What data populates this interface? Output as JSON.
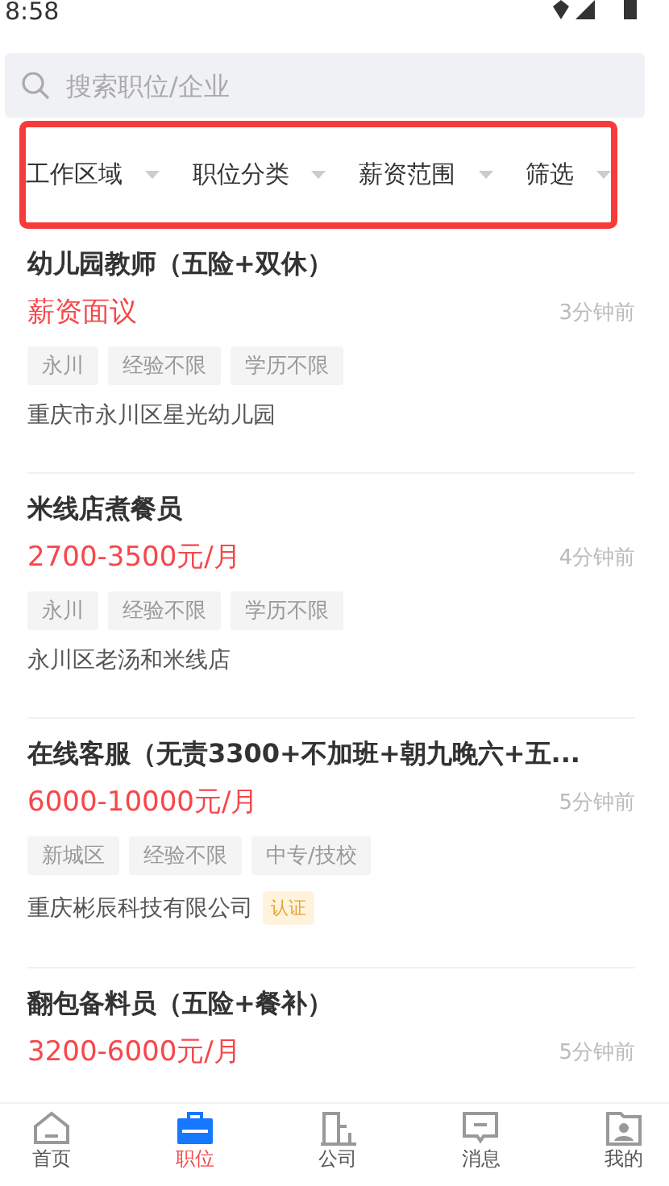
{
  "status_bar": {
    "time": "8:58"
  },
  "search": {
    "placeholder": "搜索职位/企业"
  },
  "filters": [
    {
      "label": "工作区域"
    },
    {
      "label": "职位分类"
    },
    {
      "label": "薪资范围"
    },
    {
      "label": "筛选"
    }
  ],
  "jobs": [
    {
      "title": "幼儿园教师（五险+双休）",
      "salary": "薪资面议",
      "time": "3分钟前",
      "tags": [
        "永川",
        "经验不限",
        "学历不限"
      ],
      "company": "重庆市永川区星光幼儿园"
    },
    {
      "title": "米线店煮餐员",
      "salary": "2700-3500元/月",
      "time": "4分钟前",
      "tags": [
        "永川",
        "经验不限",
        "学历不限"
      ],
      "company": "永川区老汤和米线店"
    },
    {
      "title": "在线客服（无责3300+不加班+朝九晚六+五...",
      "salary": "6000-10000元/月",
      "time": "5分钟前",
      "tags": [
        "新城区",
        "经验不限",
        "中专/技校"
      ],
      "company": "重庆彬辰科技有限公司",
      "badge": "认证"
    },
    {
      "title": "翻包备料员（五险+餐补）",
      "salary": "3200-6000元/月",
      "time": "5分钟前"
    }
  ],
  "nav": [
    {
      "label": "首页",
      "selected": false
    },
    {
      "label": "职位",
      "selected": true
    },
    {
      "label": "公司",
      "selected": false
    },
    {
      "label": "消息",
      "selected": false
    },
    {
      "label": "我的",
      "selected": false
    }
  ]
}
